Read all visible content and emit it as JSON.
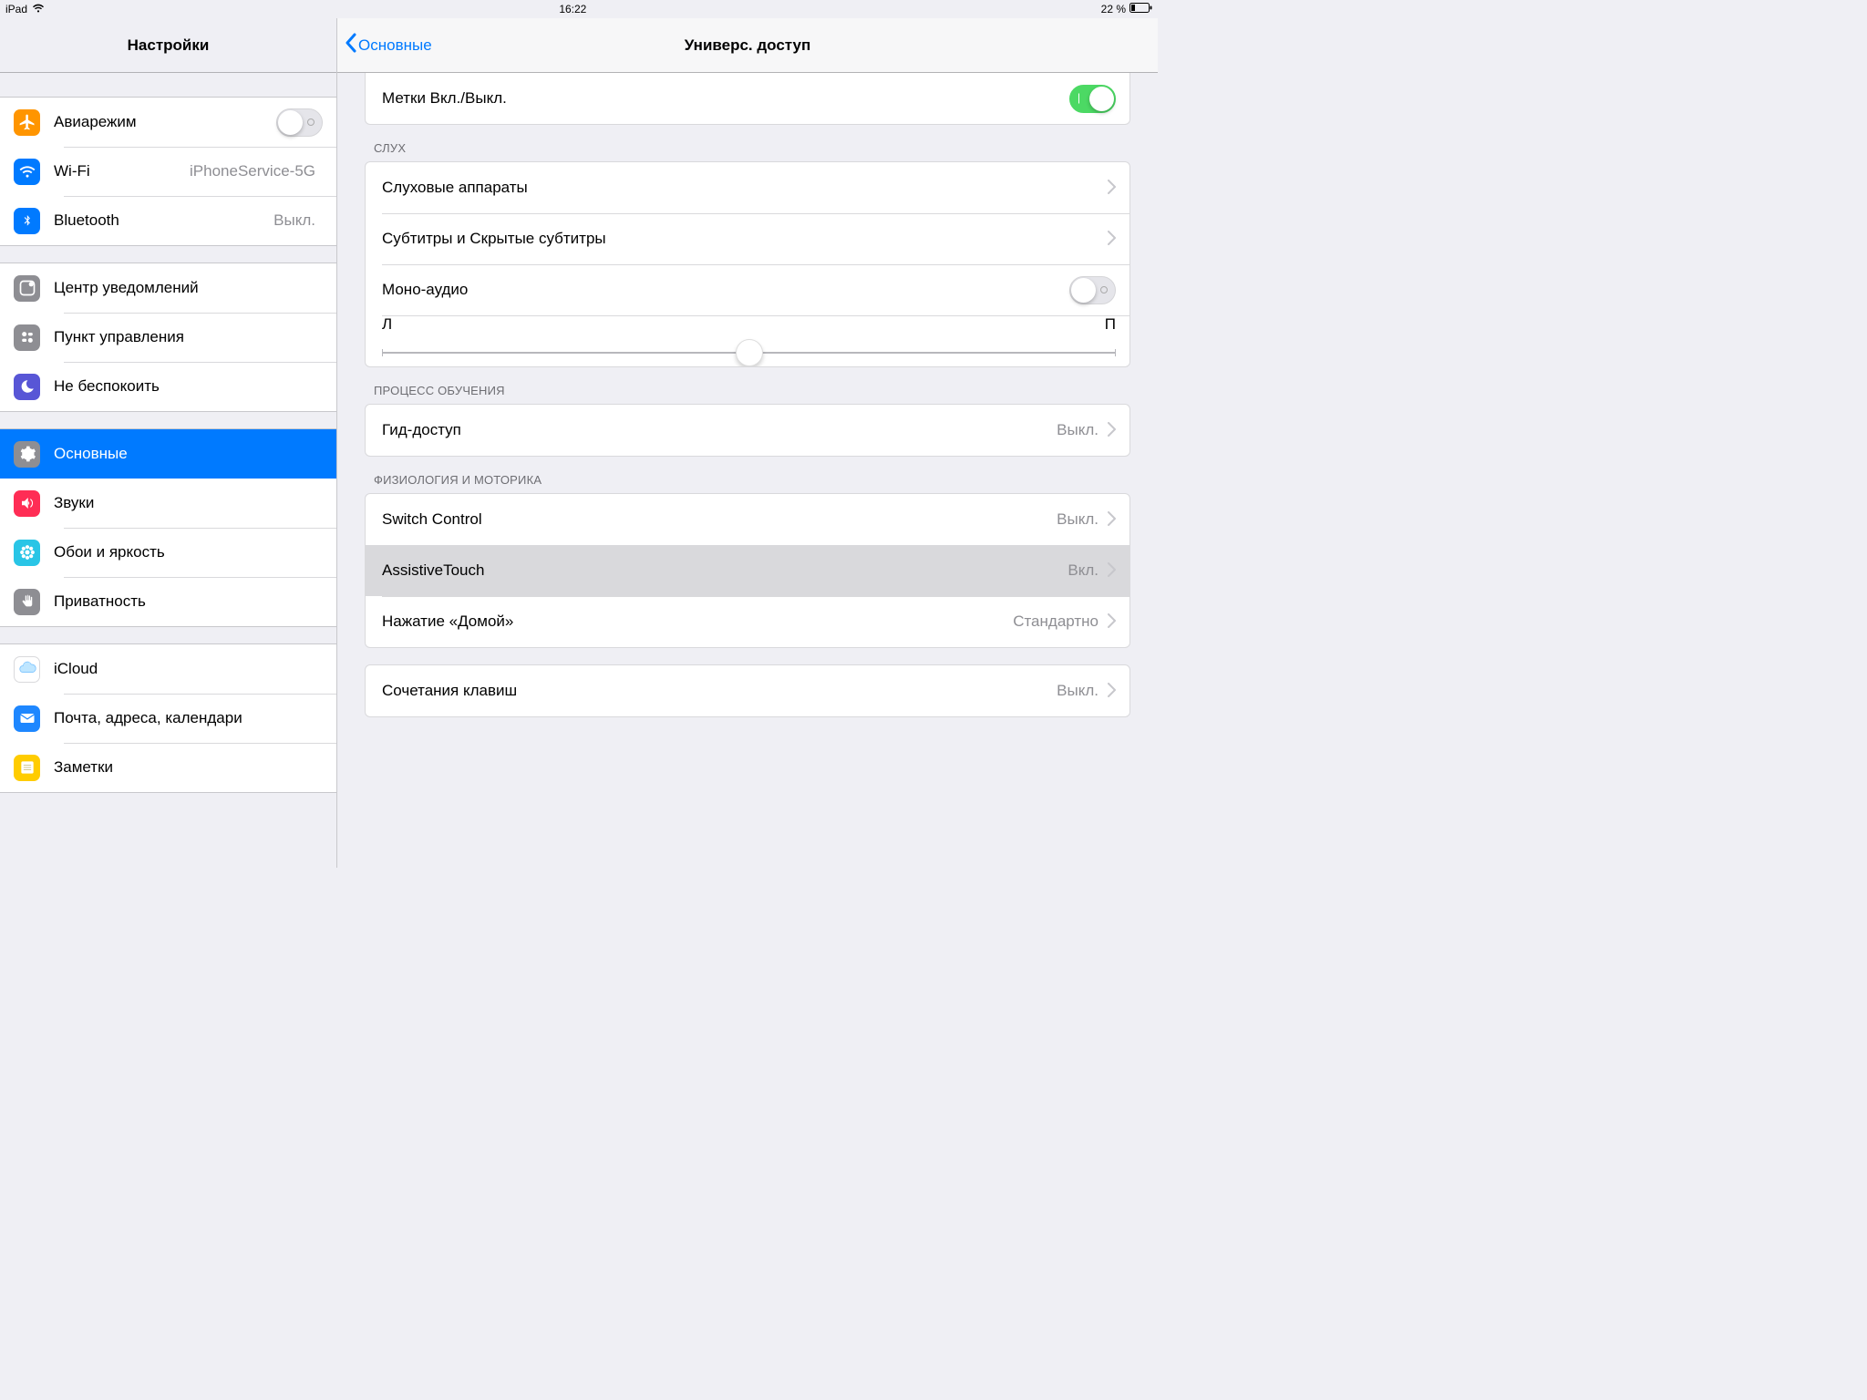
{
  "statusbar": {
    "device": "iPad",
    "time": "16:22",
    "battery": "22 %"
  },
  "sidebar": {
    "title": "Настройки",
    "groups": [
      {
        "items": [
          {
            "id": "airplane",
            "icon": "airplane",
            "color": "#ff9500",
            "label": "Авиарежим",
            "toggle": false
          },
          {
            "id": "wifi",
            "icon": "wifi",
            "color": "#007aff",
            "label": "Wi-Fi",
            "value": "iPhoneService-5G"
          },
          {
            "id": "bluetooth",
            "icon": "bluetooth",
            "color": "#007aff",
            "label": "Bluetooth",
            "value": "Выкл."
          }
        ]
      },
      {
        "items": [
          {
            "id": "notif",
            "icon": "notif",
            "color": "#8e8e93",
            "label": "Центр уведомлений"
          },
          {
            "id": "control",
            "icon": "control",
            "color": "#8e8e93",
            "label": "Пункт управления"
          },
          {
            "id": "dnd",
            "icon": "moon",
            "color": "#5856d6",
            "label": "Не беспокоить"
          }
        ]
      },
      {
        "items": [
          {
            "id": "general",
            "icon": "gear",
            "color": "#8e8e93",
            "label": "Основные",
            "selected": true
          },
          {
            "id": "sounds",
            "icon": "speaker",
            "color": "#ff2d55",
            "label": "Звуки"
          },
          {
            "id": "wallpaper",
            "icon": "flower",
            "color": "#29c5e6",
            "label": "Обои и яркость"
          },
          {
            "id": "privacy",
            "icon": "hand",
            "color": "#8e8e93",
            "label": "Приватность"
          }
        ]
      },
      {
        "items": [
          {
            "id": "icloud",
            "icon": "cloud",
            "color": "#ffffff",
            "label": "iCloud"
          },
          {
            "id": "mail",
            "icon": "mail",
            "color": "#1e87ff",
            "label": "Почта, адреса, календари"
          },
          {
            "id": "notes",
            "icon": "notes",
            "color": "#ffcc00",
            "label": "Заметки"
          }
        ]
      }
    ]
  },
  "detail": {
    "back": "Основные",
    "title": "Универс. доступ",
    "groups": [
      {
        "partial": true,
        "items": [
          {
            "id": "labels",
            "label": "Метки Вкл./Выкл.",
            "toggle": true,
            "on": true
          }
        ]
      },
      {
        "header": "СЛУХ",
        "items": [
          {
            "id": "hearing",
            "label": "Слуховые аппараты",
            "disclosure": true
          },
          {
            "id": "subtitles",
            "label": "Субтитры и Скрытые субтитры",
            "disclosure": true
          },
          {
            "id": "mono",
            "label": "Моно-аудио",
            "toggle": true,
            "on": false
          },
          {
            "id": "balance",
            "slider": true,
            "left": "Л",
            "right": "П",
            "pos": 50
          }
        ]
      },
      {
        "header": "ПРОЦЕСС ОБУЧЕНИЯ",
        "items": [
          {
            "id": "guided",
            "label": "Гид-доступ",
            "value": "Выкл.",
            "disclosure": true
          }
        ]
      },
      {
        "header": "ФИЗИОЛОГИЯ И МОТОРИКА",
        "items": [
          {
            "id": "switch",
            "label": "Switch Control",
            "value": "Выкл.",
            "disclosure": true
          },
          {
            "id": "assistive",
            "label": "AssistiveTouch",
            "value": "Вкл.",
            "disclosure": true,
            "pressed": true
          },
          {
            "id": "home",
            "label": "Нажатие «Домой»",
            "value": "Стандартно",
            "disclosure": true
          }
        ]
      },
      {
        "items": [
          {
            "id": "shortcut",
            "label": "Сочетания клавиш",
            "value": "Выкл.",
            "disclosure": true
          }
        ]
      }
    ]
  }
}
